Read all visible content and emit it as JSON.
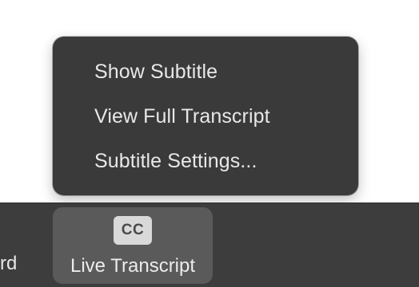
{
  "menu": {
    "items": [
      {
        "label": "Show Subtitle"
      },
      {
        "label": "View Full Transcript"
      },
      {
        "label": "Subtitle Settings..."
      }
    ]
  },
  "toolbar": {
    "prev_label_partial": "rd",
    "live_transcript": {
      "icon_text": "CC",
      "label": "Live Transcript"
    }
  },
  "colors": {
    "menu_bg": "#3a3a3a",
    "toolbar_bg": "#3d3d3d",
    "active_button_bg": "#5a5a5a",
    "cc_icon_bg": "#d9d9d9"
  }
}
